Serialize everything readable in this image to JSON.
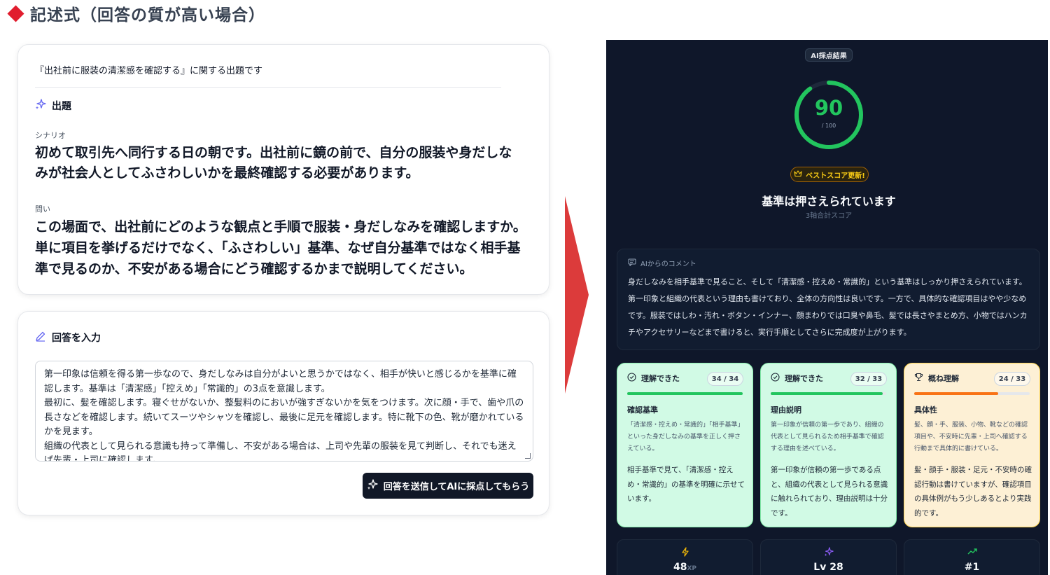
{
  "heading": "記述式（回答の質が高い場合）",
  "question": {
    "intro": "『出社前に服装の清潔感を確認する』に関する出題です",
    "section_label": "出題",
    "scenario_label": "シナリオ",
    "scenario_text": "初めて取引先へ同行する日の朝です。出社前に鏡の前で、自分の服装や身だしなみが社会人としてふさわしいかを最終確認する必要があります。",
    "question_label": "問い",
    "question_text": "この場面で、出社前にどのような観点と手順で服装・身だしなみを確認しますか。単に項目を挙げるだけでなく、「ふさわしい」基準、なぜ自分基準ではなく相手基準で見るのか、不安がある場合にどう確認するかまで説明してください。"
  },
  "answer": {
    "section_label": "回答を入力",
    "paragraphs": [
      "第一印象は信頼を得る第一歩なので、身だしなみは自分がよいと思うかではなく、相手が快いと感じるかを基準に確認します。基準は「清潔感」「控えめ」「常識的」の3点を意識します。",
      "最初に、髪を確認します。寝ぐせがないか、整髪料のにおいが強すぎないかを気をつけます。次に顔・手で、歯や爪の長さなどを確認します。続いてスーツやシャツを確認し、最後に足元を確認します。特に靴下の色、靴が磨かれているかを見ます。",
      "組織の代表として見られる意識も持って準備し、不安がある場合は、上司や先輩の服装を見て判断し、それでも迷えば先輩・上司に確認します。"
    ],
    "submit_label": "回答を送信してAIに採点してもらう"
  },
  "result": {
    "badge": "AI採点結果",
    "score": "90",
    "score_max": "/ 100",
    "score_fraction": 0.9,
    "best_label": "ベストスコア更新!",
    "verdict": "基準は押さえられています",
    "verdict_sub": "3軸合計スコア",
    "comment_title": "AIからのコメント",
    "comment_text": "身だしなみを相手基準で見ること、そして「清潔感・控えめ・常識的」という基準はしっかり押さえられています。第一印象と組織の代表という理由も書けており、全体の方向性は良いです。一方で、具体的な確認項目はやや少なめです。服装ではしわ・汚れ・ボタン・インナー、顔まわりでは口臭や鼻毛、髪では長さやまとめ方、小物ではハンカチやアクセサリーなどまで書けると、実行手順としてさらに完成度が上がります。",
    "axes": [
      {
        "status": "理解できた",
        "score": "34 / 34",
        "fraction": 1.0,
        "color": "#22c55e",
        "name": "確認基準",
        "criteria": "「清潔感・控えめ・常識的」「相手基準」といった身だしなみの基準を正しく押さえている。",
        "evaluation": "相手基準で見て、「清潔感・控えめ・常識的」の基準を明確に示せています。"
      },
      {
        "status": "理解できた",
        "score": "32 / 33",
        "fraction": 0.97,
        "color": "#22c55e",
        "name": "理由説明",
        "criteria": "第一印象が信頼の第一歩であり、組織の代表として見られるため相手基準で確認する理由を述べている。",
        "evaluation": "第一印象が信頼の第一歩である点と、組織の代表として見られる意識に触れられており、理由説明は十分です。"
      },
      {
        "status": "概ね理解",
        "score": "24 / 33",
        "fraction": 0.73,
        "color": "#f97316",
        "name": "具体性",
        "criteria": "髪、顔・手、服装、小物、靴などの確認項目や、不安時に先輩・上司へ確認する行動まで具体的に書けている。",
        "evaluation": "髪・顔手・服装・足元・不安時の確認行動は書けていますが、確認項目の具体例がもう少しあるとより実践的です。"
      }
    ],
    "stats": [
      {
        "value": "48",
        "unit": "XP",
        "icon": "lightning-icon",
        "color": "#eab308"
      },
      {
        "value": "Lv 28",
        "unit": "",
        "icon": "sparkle-icon",
        "color": "#8b5cf6"
      },
      {
        "value": "#1",
        "unit": "",
        "icon": "trending-up-icon",
        "color": "#22c55e"
      }
    ]
  }
}
